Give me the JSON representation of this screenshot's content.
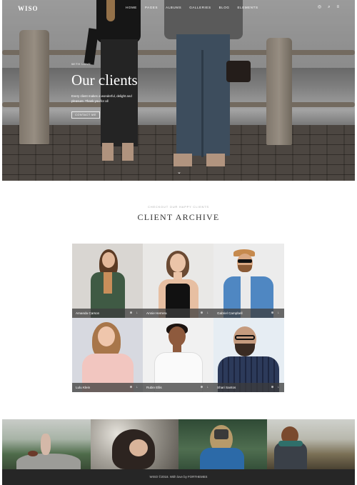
{
  "nav": {
    "logo": "WISO",
    "items": [
      "HOME",
      "PAGES",
      "ALBUMS",
      "GALLERIES",
      "BLOG",
      "ELEMENTS"
    ],
    "icons": [
      "instagram-icon",
      "search-icon",
      "menu-icon"
    ]
  },
  "hero": {
    "small": "WITH LOVE",
    "title": "Our clients",
    "desc": "Every client makes a wonderful, delight and pleasure. Thank you for all",
    "button": "CONTACT ME"
  },
  "archive": {
    "kicker": "CHECKOUT OUR HAPPY CLIENTS",
    "title": "CLIENT ARCHIVE",
    "clients": [
      {
        "name": "Amanda Carson",
        "icons": "⊕ ↓"
      },
      {
        "name": "Annie Herrera",
        "icons": "⊕ ↓"
      },
      {
        "name": "Gabriel Campbell",
        "icons": "⊕ ↓"
      },
      {
        "name": "Lulu Klein",
        "icons": "⊕ ↓"
      },
      {
        "name": "Rubin Ellis",
        "icons": "⊕ ↓"
      },
      {
        "name": "Shari Santos",
        "icons": "⊕ ↓"
      }
    ]
  },
  "footer": {
    "text": "WISO ©2018. With love by FORTHEMES"
  },
  "colors": {
    "footer_bg": "#262626",
    "caption_bg": "#3c3c3c"
  }
}
